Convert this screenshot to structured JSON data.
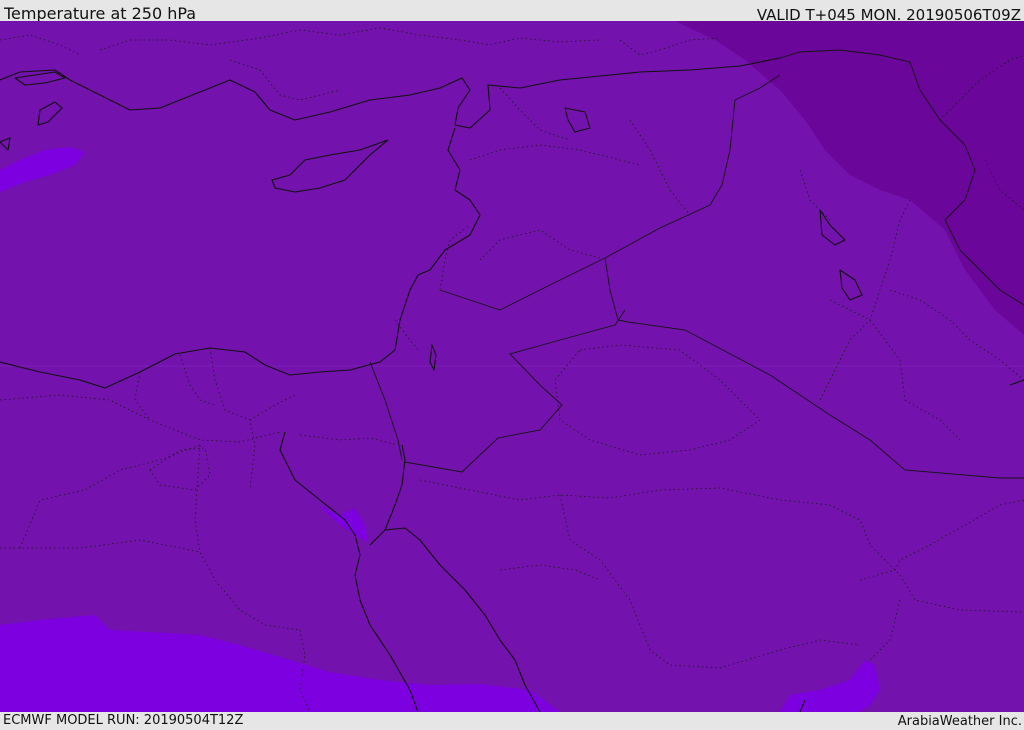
{
  "header": {
    "title": "Temperature at 250 hPa",
    "valid_time": "VALID T+045 MON. 20190506T09Z"
  },
  "footer": {
    "model_run": "ECMWF MODEL RUN: 20190504T12Z",
    "credit": "ArabiaWeather Inc."
  },
  "map": {
    "colors": {
      "base_fill": "#7412ad",
      "cold_band": "#6a0699",
      "warm_band": "#7d00e0",
      "coast_line": "#111111",
      "border_line": "#1a1a1a"
    }
  }
}
